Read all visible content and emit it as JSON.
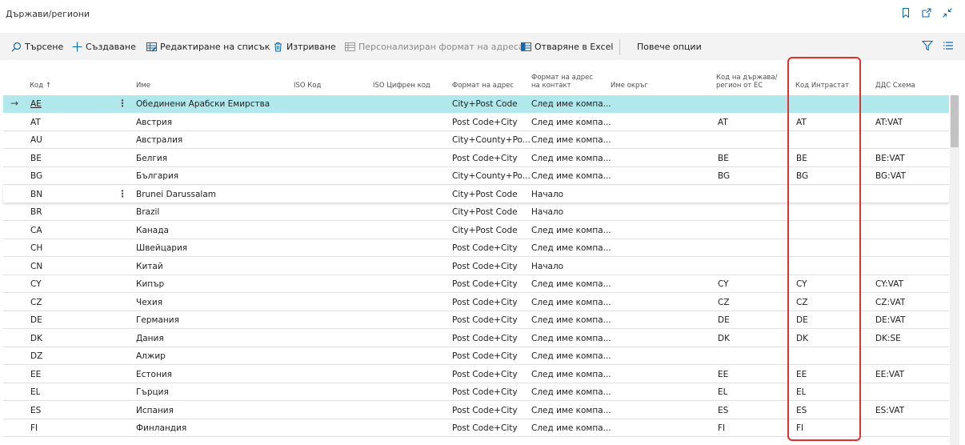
{
  "page": {
    "title": "Държави/региони"
  },
  "actions": {
    "search": "Търсене",
    "create": "Създаване",
    "edit_list": "Редактиране на списък",
    "delete": "Изтриване",
    "address_format": "Персонализиран формат на адреса",
    "excel": "Отваряне в Excel",
    "more": "Повече опции"
  },
  "columns": {
    "code": "Код ↑",
    "name": "Име",
    "iso": "ISO Код",
    "iso_num": "ISO Цифрен код",
    "addr_fmt": "Формат на адрес",
    "contact_fmt_1": "Формат на адрес",
    "contact_fmt_2": "на контакт",
    "county": "Име окръг",
    "eu_1": "Код на държава/",
    "eu_2": "регион от ЕС",
    "intrastat": "Код Интрастат",
    "vat": "ДДС Схема"
  },
  "rows": [
    {
      "code": "AE",
      "name": "Обединени Арабски Емирства",
      "fmt": "City+Post Code",
      "cfmt": "След име компа...",
      "eu": "",
      "intra": "",
      "vat": ""
    },
    {
      "code": "AT",
      "name": "Австрия",
      "fmt": "Post Code+City",
      "cfmt": "След име компа...",
      "eu": "AT",
      "intra": "AT",
      "vat": "AT:VAT"
    },
    {
      "code": "AU",
      "name": "Австралия",
      "fmt": "City+County+Po...",
      "cfmt": "След име компа...",
      "eu": "",
      "intra": "",
      "vat": ""
    },
    {
      "code": "BE",
      "name": "Белгия",
      "fmt": "Post Code+City",
      "cfmt": "След име компа...",
      "eu": "BE",
      "intra": "BE",
      "vat": "BE:VAT"
    },
    {
      "code": "BG",
      "name": "България",
      "fmt": "City+County+Po...",
      "cfmt": "След име компа...",
      "eu": "BG",
      "intra": "BG",
      "vat": "BG:VAT"
    },
    {
      "code": "BN",
      "name": "Brunei Darussalam",
      "fmt": "City+Post Code",
      "cfmt": "Начало",
      "eu": "",
      "intra": "",
      "vat": ""
    },
    {
      "code": "BR",
      "name": "Brazil",
      "fmt": "City+Post Code",
      "cfmt": "Начало",
      "eu": "",
      "intra": "",
      "vat": ""
    },
    {
      "code": "CA",
      "name": "Канада",
      "fmt": "City+Post Code",
      "cfmt": "След име компа...",
      "eu": "",
      "intra": "",
      "vat": ""
    },
    {
      "code": "CH",
      "name": "Швейцария",
      "fmt": "Post Code+City",
      "cfmt": "След име компа...",
      "eu": "",
      "intra": "",
      "vat": ""
    },
    {
      "code": "CN",
      "name": "Китай",
      "fmt": "Post Code+City",
      "cfmt": "Начало",
      "eu": "",
      "intra": "",
      "vat": ""
    },
    {
      "code": "CY",
      "name": "Кипър",
      "fmt": "Post Code+City",
      "cfmt": "След име компа...",
      "eu": "CY",
      "intra": "CY",
      "vat": "CY:VAT"
    },
    {
      "code": "CZ",
      "name": "Чехия",
      "fmt": "Post Code+City",
      "cfmt": "След име компа...",
      "eu": "CZ",
      "intra": "CZ",
      "vat": "CZ:VAT"
    },
    {
      "code": "DE",
      "name": "Германия",
      "fmt": "Post Code+City",
      "cfmt": "След име компа...",
      "eu": "DE",
      "intra": "DE",
      "vat": "DE:VAT"
    },
    {
      "code": "DK",
      "name": "Дания",
      "fmt": "Post Code+City",
      "cfmt": "След име компа...",
      "eu": "DK",
      "intra": "DK",
      "vat": "DK:SE"
    },
    {
      "code": "DZ",
      "name": "Алжир",
      "fmt": "Post Code+City",
      "cfmt": "След име компа...",
      "eu": "",
      "intra": "",
      "vat": ""
    },
    {
      "code": "EE",
      "name": "Естония",
      "fmt": "Post Code+City",
      "cfmt": "След име компа...",
      "eu": "EE",
      "intra": "EE",
      "vat": "EE:VAT"
    },
    {
      "code": "EL",
      "name": "Гърция",
      "fmt": "Post Code+City",
      "cfmt": "След име компа...",
      "eu": "EL",
      "intra": "EL",
      "vat": ""
    },
    {
      "code": "ES",
      "name": "Испания",
      "fmt": "Post Code+City",
      "cfmt": "След име компа...",
      "eu": "ES",
      "intra": "ES",
      "vat": "ES:VAT"
    },
    {
      "code": "FI",
      "name": "Финландия",
      "fmt": "Post Code+City",
      "cfmt": "След име компа...",
      "eu": "FI",
      "intra": "FI",
      "vat": ""
    }
  ]
}
